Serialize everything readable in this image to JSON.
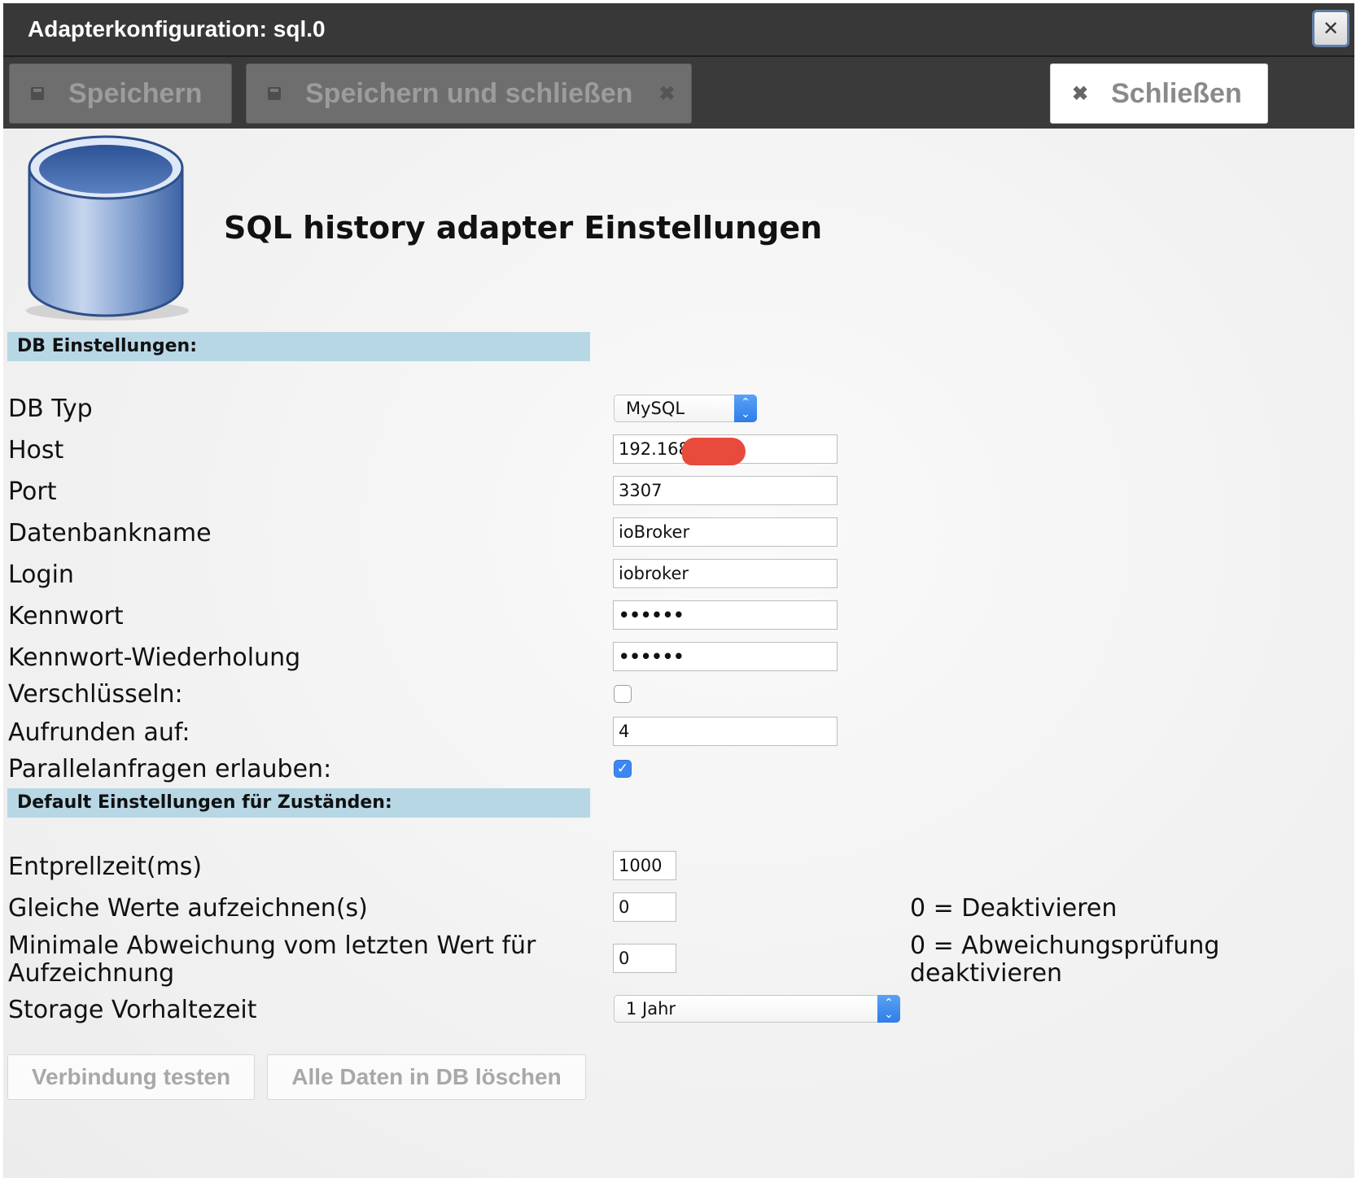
{
  "window": {
    "title": "Adapterkonfiguration: sql.0",
    "close_icon": "close-icon"
  },
  "toolbar": {
    "save_label": "Speichern",
    "save_close_label": "Speichern und schließen",
    "close_label": "Schließen"
  },
  "header": {
    "title": "SQL history adapter Einstellungen",
    "icon": "database-icon"
  },
  "db_section": {
    "title": "DB Einstellungen:",
    "db_type": {
      "label": "DB Typ",
      "value": "MySQL"
    },
    "host": {
      "label": "Host",
      "value": "192.168"
    },
    "port": {
      "label": "Port",
      "value": "3307"
    },
    "db_name": {
      "label": "Datenbankname",
      "value": "ioBroker"
    },
    "login": {
      "label": "Login",
      "value": "iobroker"
    },
    "password": {
      "label": "Kennwort",
      "value": "••••••"
    },
    "password_repeat": {
      "label": "Kennwort-Wiederholung",
      "value": "••••••"
    },
    "encrypt": {
      "label": "Verschlüsseln:",
      "checked": false
    },
    "round": {
      "label": "Aufrunden auf:",
      "value": "4"
    },
    "parallel": {
      "label": "Parallelanfragen erlauben:",
      "checked": true
    }
  },
  "defaults_section": {
    "title": "Default Einstellungen für Zuständen:",
    "debounce": {
      "label": "Entprellzeit(ms)",
      "value": "1000"
    },
    "same_values": {
      "label": "Gleiche Werte aufzeichnen(s)",
      "value": "0",
      "hint": "0 = Deaktivieren"
    },
    "min_change": {
      "label_line1": "Minimale Abweichung vom letzten Wert für",
      "label_line2": "Aufzeichnung",
      "value": "0",
      "hint_line1": "0 = Abweichungsprüfung",
      "hint_line2": "deaktivieren"
    },
    "retention": {
      "label": "Storage Vorhaltezeit",
      "value": "1 Jahr"
    }
  },
  "footer": {
    "test_connection_label": "Verbindung testen",
    "delete_all_label": "Alle Daten in DB löschen"
  },
  "colors": {
    "section_bg": "#b7d7e5",
    "titlebar_bg": "#383838",
    "checkbox_accent": "#3d87f2",
    "redaction": "#e84a3b"
  }
}
